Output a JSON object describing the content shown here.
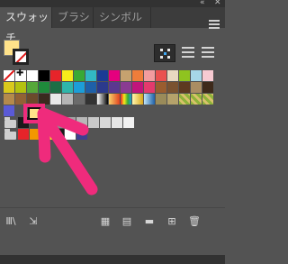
{
  "window": {
    "collapse_glyph": "«",
    "close_glyph": "✕"
  },
  "tabs": [
    {
      "label": "スウォッチ",
      "active": true
    },
    {
      "label": "ブラシ",
      "active": false
    },
    {
      "label": "シンボル",
      "active": false
    }
  ],
  "fill_stroke": {
    "fill_color": "#ffe28a",
    "stroke": "none"
  },
  "view_buttons": [
    {
      "name": "large-thumbnail-view",
      "active": true
    },
    {
      "name": "list-view",
      "active": false
    },
    {
      "name": "small-thumbnail-view",
      "active": false
    }
  ],
  "swatch_rows": [
    [
      "none",
      "registration",
      "#ffffff",
      "#000000",
      "#e6242a",
      "#f7ea1b",
      "#38a935",
      "#32b8c4",
      "#1b3b95",
      "#e5007e",
      "#c6a26f",
      "#ef7d3a",
      "#f29c9f",
      "#e9514f",
      "#e9d9c1",
      "#8fc31f",
      "#a6d7e8",
      "#f7cad2"
    ],
    [
      "#d9c91c",
      "#b3c20f",
      "#56a83a",
      "#1f8a3b",
      "#1d6e45",
      "#2eb6aa",
      "#1c9ed8",
      "#1e60a8",
      "#2b3a8c",
      "#5b3890",
      "#8a3c92",
      "#c1157c",
      "#e33a6d",
      "#9a5d2f",
      "#7a5230",
      "#5d3a20",
      "#aa8d63",
      "#3e2a1b"
    ],
    [
      "#b48a4c",
      "#916235",
      "#6b4a2b",
      "#3a2a1f",
      "#e8e8e8",
      "#b5b5b5",
      "#6b6b6b",
      "#333333",
      "gradient-bw",
      "gradient-orange",
      "gradient-rainbow",
      "gradient-yellow",
      "gradient-blue",
      "#9a8b5a",
      "#b5a26b",
      "pattern-1",
      "pattern-2",
      "pattern-3"
    ]
  ],
  "row4_swatches": [
    "#5a5ad6",
    "#ffe28a"
  ],
  "gray_group": [
    "#1a1a1a",
    "#4b4b4b",
    "#6e6e6e",
    "#8c8c8c",
    "#a3a3a3",
    "#b8b8b8",
    "#c9c9c9",
    "#d8d8d8",
    "#e6e6e6",
    "#f2f2f2"
  ],
  "color_group": [
    "#e6242a",
    "#f39800",
    "#f7ea1b",
    "#1a1a1a",
    "#ffffff",
    "#3f3f8f"
  ],
  "highlight": {
    "color": "#ef2b7c"
  },
  "toolbar": [
    {
      "name": "swatch-library-menu-icon",
      "glyph": "Ⅲ\\"
    },
    {
      "name": "place-swatches-icon",
      "glyph": "⇲"
    },
    {
      "name": "show-swatch-kinds-icon",
      "glyph": "▦"
    },
    {
      "name": "swatch-options-icon",
      "glyph": "▤"
    },
    {
      "name": "new-color-group-icon",
      "glyph": "▬"
    },
    {
      "name": "new-swatch-icon",
      "glyph": "⊞"
    },
    {
      "name": "delete-swatch-icon",
      "glyph": "🗑"
    }
  ]
}
